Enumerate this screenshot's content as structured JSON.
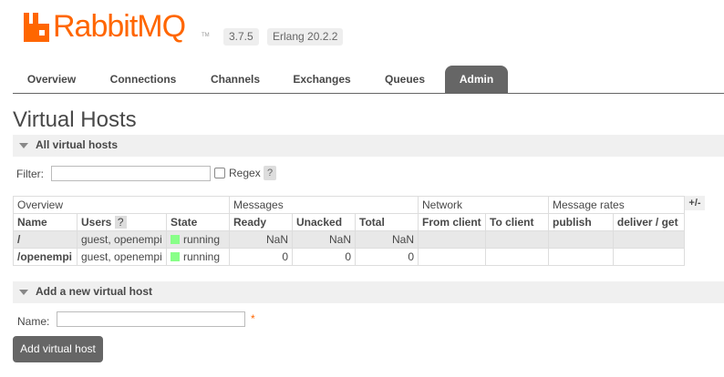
{
  "header": {
    "logo_text": "RabbitMQ",
    "tm": "TM",
    "version": "3.7.5",
    "erlang": "Erlang 20.2.2",
    "brand_color": "#ff6600"
  },
  "tabs": [
    {
      "label": "Overview"
    },
    {
      "label": "Connections"
    },
    {
      "label": "Channels"
    },
    {
      "label": "Exchanges"
    },
    {
      "label": "Queues"
    },
    {
      "label": "Admin",
      "active": true
    }
  ],
  "page_title": "Virtual Hosts",
  "all_vhosts": {
    "title": "All virtual hosts",
    "filter_label": "Filter:",
    "regex_label": "Regex",
    "help": "?",
    "plus_minus": "+/-",
    "group_headers": [
      "Overview",
      "Messages",
      "Network",
      "Message rates"
    ],
    "columns": [
      "Name",
      "Users",
      "State",
      "Ready",
      "Unacked",
      "Total",
      "From client",
      "To client",
      "publish",
      "deliver / get"
    ],
    "rows": [
      {
        "name": "/",
        "users": "guest, openempi",
        "state": "running",
        "ready": "NaN",
        "unacked": "NaN",
        "total": "NaN",
        "from_client": "",
        "to_client": "",
        "publish": "",
        "deliver_get": ""
      },
      {
        "name": "/openempi",
        "users": "guest, openempi",
        "state": "running",
        "ready": "0",
        "unacked": "0",
        "total": "0",
        "from_client": "",
        "to_client": "",
        "publish": "",
        "deliver_get": ""
      }
    ]
  },
  "add_vhost": {
    "title": "Add a new virtual host",
    "name_label": "Name:",
    "required_mark": "*",
    "button_label": "Add virtual host"
  }
}
